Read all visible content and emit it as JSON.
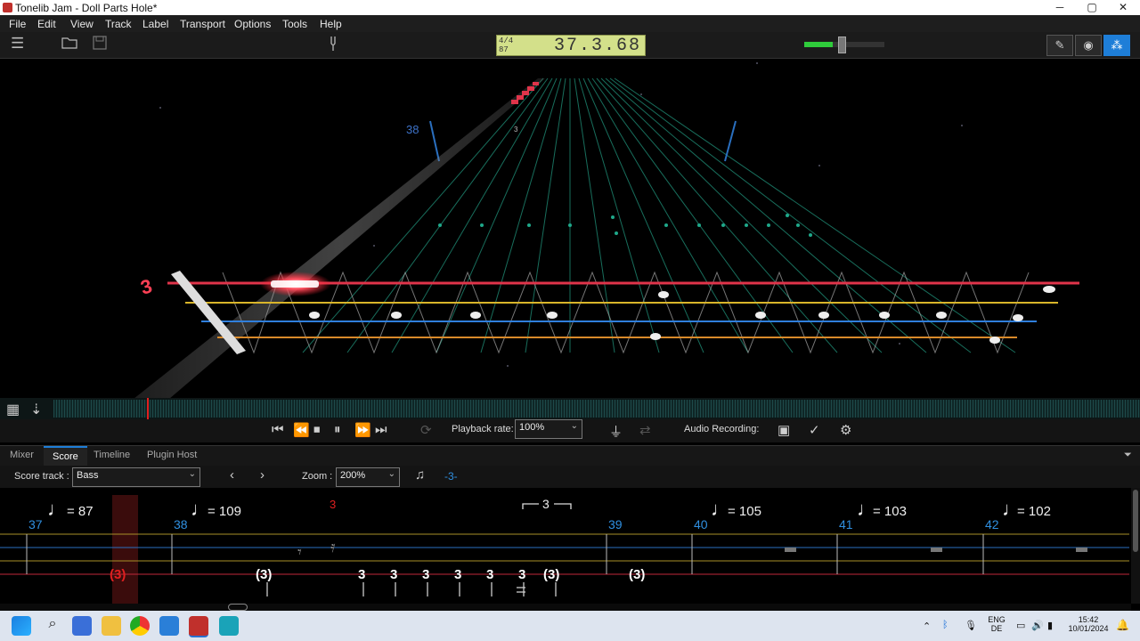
{
  "window": {
    "title": "Tonelib Jam - Doll Parts  Hole*",
    "min": "─",
    "max": "▢",
    "close": "✕"
  },
  "menu": [
    "File",
    "Edit",
    "View",
    "Track",
    "Label",
    "Transport",
    "Options",
    "Tools",
    "Help"
  ],
  "lcd": {
    "time_signature": "4/4",
    "tempo": "87",
    "position": "37.3.68"
  },
  "volume": {
    "level": 0.35
  },
  "highway": {
    "measure_label": "38",
    "fret_number": "3",
    "small_marker": "3"
  },
  "transport": {
    "playback_rate_label": "Playback rate:",
    "playback_rate_value": "100%",
    "audio_recording_label": "Audio Recording:"
  },
  "tabs": [
    "Mixer",
    "Score",
    "Timeline",
    "Plugin Host"
  ],
  "active_tab": "Score",
  "score_bar": {
    "track_label": "Score track :",
    "track_value": "Bass",
    "zoom_label": "Zoom :",
    "zoom_value": "200%",
    "transpose": "-3-"
  },
  "score": {
    "measures": [
      {
        "num": "37",
        "tempo": "= 87"
      },
      {
        "num": "38",
        "tempo": "= 109"
      },
      {
        "num": "39",
        "tempo": ""
      },
      {
        "num": "40",
        "tempo": "= 105"
      },
      {
        "num": "41",
        "tempo": "= 103"
      },
      {
        "num": "42",
        "tempo": "= 102"
      }
    ],
    "triplet": "3",
    "red_marker": "3",
    "tab_notes": [
      "(3)",
      "(3)",
      "3",
      "3",
      "3",
      "3",
      "3",
      "3",
      "(3)",
      "(3)"
    ]
  },
  "taskbar": {
    "lang_top": "ENG",
    "lang_bottom": "DE",
    "time": "15:42",
    "date": "10/01/2024"
  },
  "colors": {
    "accent": "#1e7ed8",
    "lcd": "#d3e08a",
    "string_red": "#e0344a",
    "string_yellow": "#d9b52a",
    "string_blue": "#2f7fdc",
    "string_orange": "#d98a2a",
    "measure_blue": "#2f8fe0"
  }
}
